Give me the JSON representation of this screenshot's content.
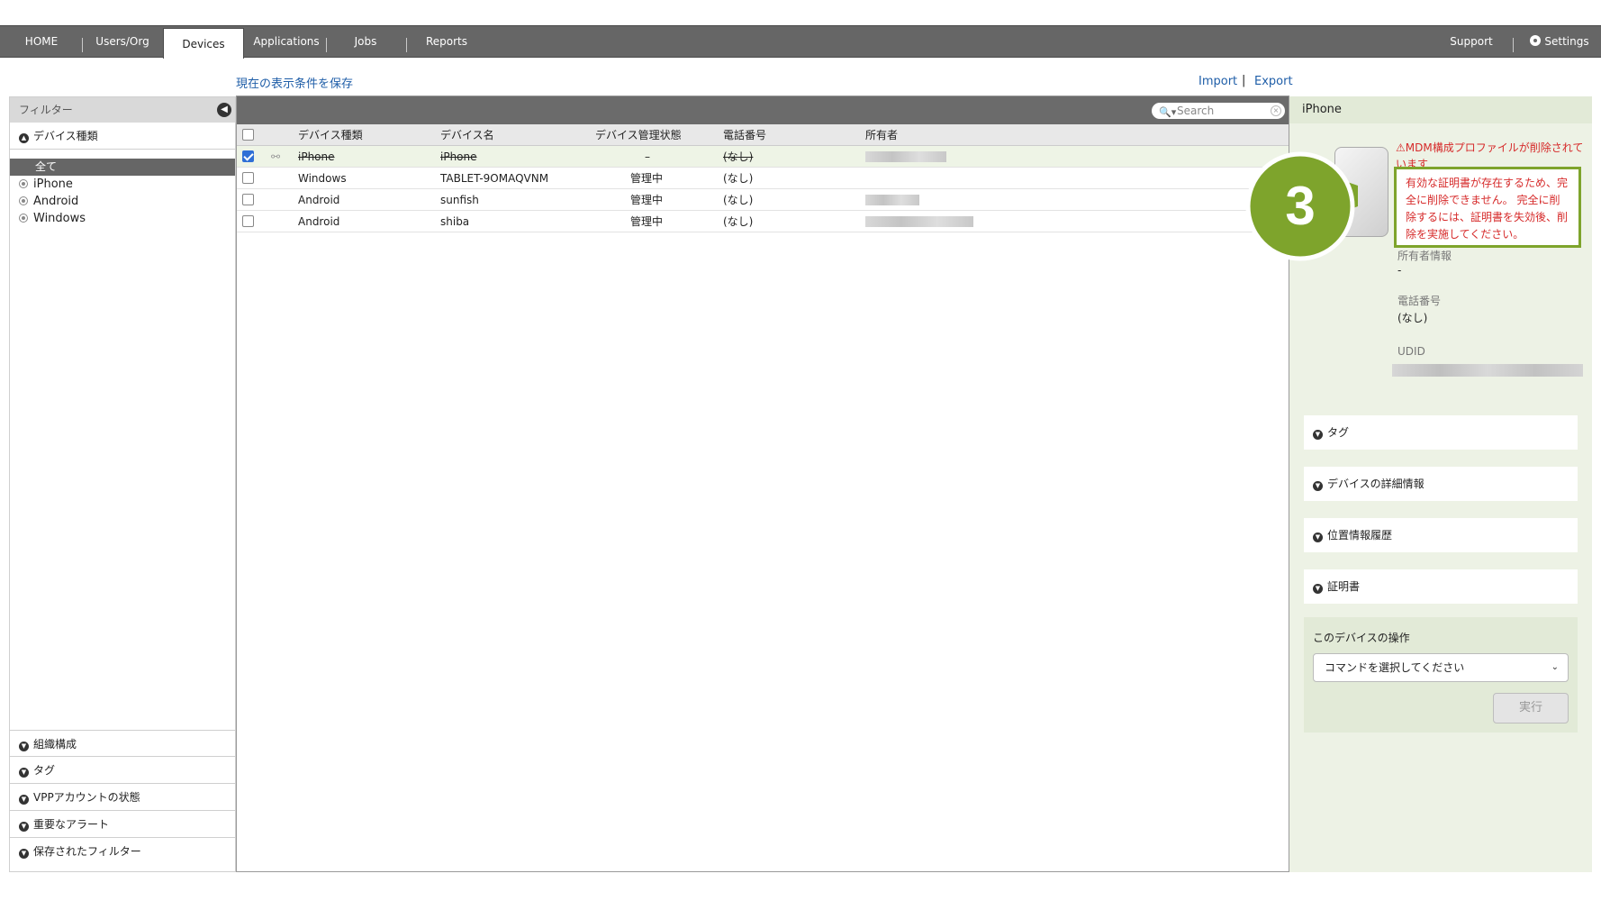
{
  "nav": {
    "items": [
      "HOME",
      "Users/Org",
      "Devices",
      "Applications",
      "Jobs",
      "Reports"
    ],
    "active": "Devices",
    "support": "Support",
    "settings": "Settings"
  },
  "toolbar": {
    "save_view": "現在の表示条件を保存",
    "import": "Import",
    "separator": "|",
    "export": "Export"
  },
  "sidebar": {
    "title": "フィルター",
    "device_type_header": "デバイス種類",
    "all": "全て",
    "types": [
      "iPhone",
      "Android",
      "Windows"
    ],
    "bottom_sections": [
      "組織構成",
      "タグ",
      "VPPアカウントの状態",
      "重要なアラート",
      "保存されたフィルター"
    ]
  },
  "search": {
    "placeholder": "Search"
  },
  "table": {
    "columns": [
      "デバイス種類",
      "デバイス名",
      "デバイス管理状態",
      "電話番号",
      "所有者"
    ],
    "rows": [
      {
        "type": "iPhone",
        "name": "iPhone",
        "status": "–",
        "phone": "(なし)",
        "checked": true
      },
      {
        "type": "Windows",
        "name": "TABLET-9OMAQVNM",
        "status": "管理中",
        "phone": "(なし)",
        "checked": false
      },
      {
        "type": "Android",
        "name": "sunfish",
        "status": "管理中",
        "phone": "(なし)",
        "checked": false
      },
      {
        "type": "Android",
        "name": "shiba",
        "status": "管理中",
        "phone": "(なし)",
        "checked": false
      }
    ]
  },
  "detail": {
    "title": "iPhone",
    "warning": "MDM構成プロファイルが削除されています",
    "owner_label": "所有者情報",
    "owner_value": "-",
    "phone_label": "電話番号",
    "phone_value": "(なし)",
    "udid_label": "UDID",
    "sections": [
      "タグ",
      "デバイスの詳細情報",
      "位置情報履歴",
      "証明書"
    ],
    "ops_title": "このデバイスの操作",
    "ops_select": "コマンドを選択してください",
    "ops_run": "実行"
  },
  "callout": {
    "number": "3",
    "text": "有効な証明書が存在するため、完全に削除できません。 完全に削除するには、証明書を失効後、削除を実施してください。"
  },
  "colors": {
    "accent_green": "#7ea42c",
    "warning_red": "#d62a2a",
    "nav_gray": "#666666"
  }
}
